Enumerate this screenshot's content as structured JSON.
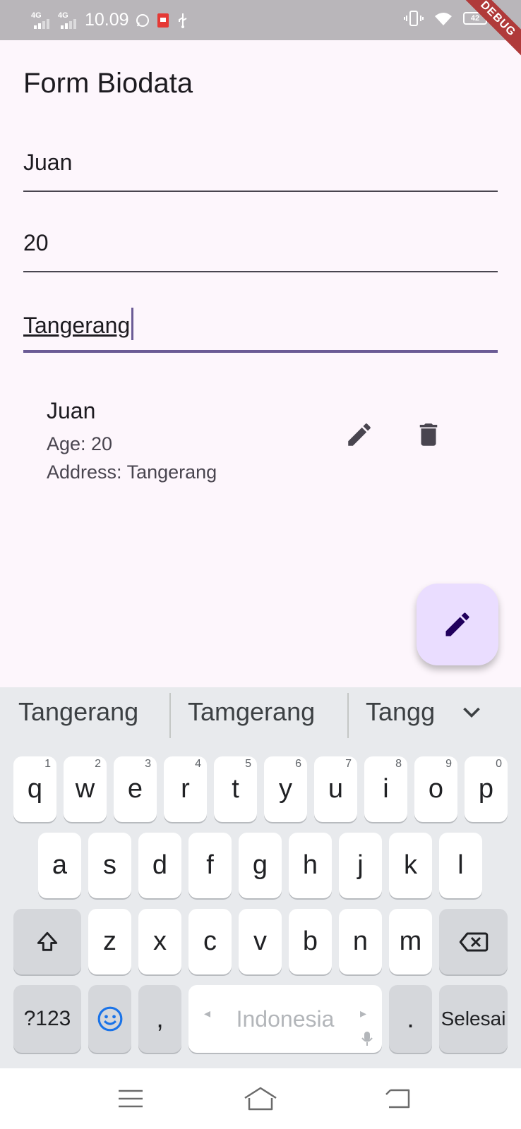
{
  "status_bar": {
    "network_1": "4G",
    "network_2": "4G",
    "time": "10.09",
    "battery": "42",
    "debug_banner": "DEBUG"
  },
  "app_bar": {
    "title": "Form Biodata"
  },
  "form": {
    "name_value": "Juan",
    "age_value": "20",
    "address_value": "Tangerang"
  },
  "list": {
    "items": [
      {
        "name": "Juan",
        "age": "Age: 20",
        "address": "Address: Tangerang"
      }
    ]
  },
  "colors": {
    "background": "#fdf6fc",
    "focus_indicator": "#6b5b95",
    "fab_background": "#eaddff",
    "debug_banner": "#b03a3a"
  },
  "keyboard": {
    "suggestions": [
      "Tangerang",
      "Tamgerang",
      "Tangg"
    ],
    "row1": [
      {
        "key": "q",
        "hint": "1"
      },
      {
        "key": "w",
        "hint": "2"
      },
      {
        "key": "e",
        "hint": "3"
      },
      {
        "key": "r",
        "hint": "4"
      },
      {
        "key": "t",
        "hint": "5"
      },
      {
        "key": "y",
        "hint": "6"
      },
      {
        "key": "u",
        "hint": "7"
      },
      {
        "key": "i",
        "hint": "8"
      },
      {
        "key": "o",
        "hint": "9"
      },
      {
        "key": "p",
        "hint": "0"
      }
    ],
    "row2": [
      "a",
      "s",
      "d",
      "f",
      "g",
      "h",
      "j",
      "k",
      "l"
    ],
    "row3": [
      "z",
      "x",
      "c",
      "v",
      "b",
      "n",
      "m"
    ],
    "symbols_key": "?123",
    "comma_key": ",",
    "space_label": "Indonesia",
    "period_key": ".",
    "done_key": "Selesai"
  }
}
